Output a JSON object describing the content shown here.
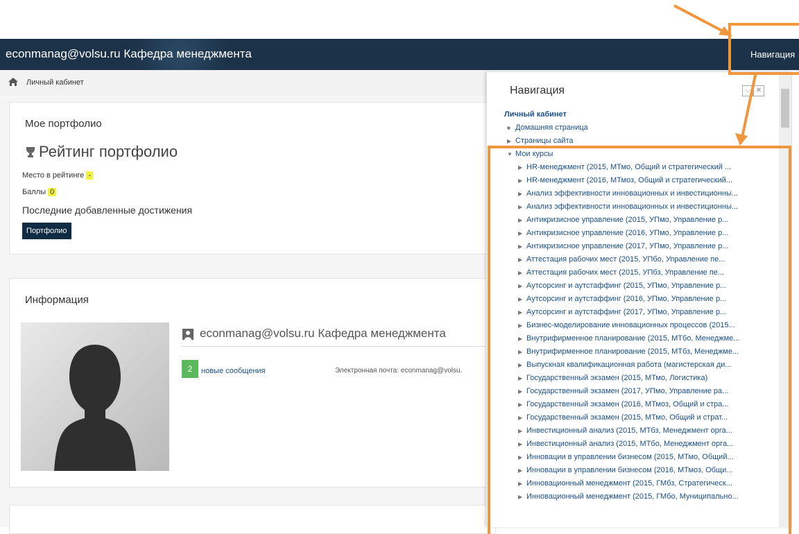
{
  "header": {
    "site_title": "econmanag@volsu.ru Кафедра менеджмента",
    "nav_link": "Навигация"
  },
  "breadcrumb": {
    "label": "Личный кабинет"
  },
  "portfolio": {
    "heading": "Мое портфолио",
    "rating_title": "Рейтинг портфолио",
    "place_label": "Место в рейтинге",
    "place_value": "-",
    "score_label": "Баллы",
    "score_value": "0",
    "recent_label": "Последние добавленные достижения",
    "button_label": "Портфолио"
  },
  "info": {
    "heading": "Информация",
    "username": "econmanag@volsu.ru Кафедра менеджмента",
    "messages_count": "2",
    "messages_label": "новые сообщения",
    "email_label": "Электронная почта: econmanag@volsu."
  },
  "navigation": {
    "title": "Навигация",
    "root": "Личный кабинет",
    "items": [
      "Домашняя страница",
      "Страницы сайта",
      "Мои курсы"
    ],
    "courses": [
      "HR-менеджмент (2015, МТмо, Общий и стратегический ...",
      "HR-менеджмент (2016, МТмоз, Общий и стратегический...",
      "Анализ эффективности инновационных и инвестиционны...",
      "Анализ эффективности инновационных и инвестиционны...",
      "Антикризисное управление (2015, УПмо, Управление р...",
      "Антикризисное управление (2016, УПмо, Управление р...",
      "Антикризисное управление (2017, УПмо, Управление р...",
      "Аттестация рабочих мест (2015, УПбо, Управление пе...",
      "Аттестация рабочих мест (2015, УПбз, Управление пе...",
      "Аутсорсинг и аутстаффинг (2015, УПмо, Управление р...",
      "Аутсорсинг и аутстаффинг (2016, УПмо, Управление р...",
      "Аутсорсинг и аутстаффинг (2017, УПмо, Управление р...",
      "Бизнес-моделирование инновационных процессов (2015...",
      "Внутрифирменное планирование (2015, МТбо, Менеджме...",
      "Внутрифирменное планирование (2015, МТбз, Менеджме...",
      "Выпускная квалификационная работа (магистерская ди...",
      "Государственный экзамен (2015, МТмо, Логистика)",
      "Государственный экзамен (2017, УПмо, Управление ра...",
      "Государственный экзамен (2016, МТмоз, Общий и стра...",
      "Государственный экзамен (2015, МТмо, Общий и страт...",
      "Инвестиционный анализ (2015, МТбз, Менеджмент орга...",
      "Инвестиционный анализ (2015, МТбо, Менеджмент орга...",
      "Инновации в управлении бизнесом (2015, МТмо, Общий...",
      "Инновации в управлении бизнесом (2016, МТмоз, Общи...",
      "Инновационный менеджмент (2015, ГМбз, Стратегическ...",
      "Инновационный менеджмент (2015, ГМбо, Муниципально..."
    ]
  },
  "colors": {
    "header_bg": "#1c3248",
    "highlight": "#f1f144",
    "annotation": "#f0963c",
    "badge_green": "#5cb85c",
    "button_dark": "#0f2c44"
  }
}
